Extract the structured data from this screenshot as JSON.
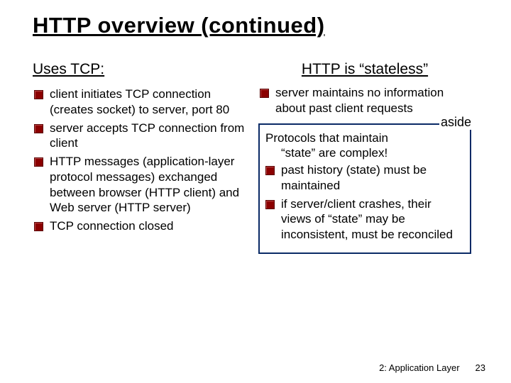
{
  "title": "HTTP overview (continued)",
  "left": {
    "heading": "Uses TCP:",
    "items": [
      "client initiates TCP connection (creates socket) to server,  port 80",
      "server accepts TCP connection from client",
      "HTTP messages (application-layer protocol messages) exchanged between browser (HTTP client) and Web server (HTTP server)",
      "TCP connection closed"
    ]
  },
  "right": {
    "heading": "HTTP is “stateless”",
    "items": [
      "server maintains no information about past client requests"
    ],
    "aside": {
      "label": "aside",
      "intro_line1": "Protocols that maintain",
      "intro_line2": "“state” are complex!",
      "items": [
        "past history (state) must be maintained",
        "if server/client crashes, their views of “state” may be inconsistent, must be reconciled"
      ]
    }
  },
  "footer": {
    "chapter": "2: Application Layer",
    "page": "23"
  }
}
